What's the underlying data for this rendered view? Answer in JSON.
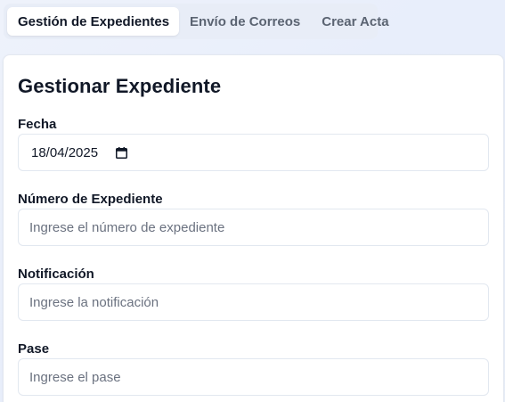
{
  "tabs": [
    {
      "label": "Gestión de Expedientes",
      "active": true
    },
    {
      "label": "Envío de Correos",
      "active": false
    },
    {
      "label": "Crear Acta",
      "active": false
    }
  ],
  "card": {
    "title": "Gestionar Expediente",
    "fields": {
      "fecha": {
        "label": "Fecha",
        "value": "18/04/2025",
        "icon": "calendar-icon"
      },
      "numero": {
        "label": "Número de Expediente",
        "placeholder": "Ingrese el número de expediente",
        "value": ""
      },
      "notificacion": {
        "label": "Notificación",
        "placeholder": "Ingrese la notificación",
        "value": ""
      },
      "pase": {
        "label": "Pase",
        "placeholder": "Ingrese el pase",
        "value": ""
      }
    }
  }
}
